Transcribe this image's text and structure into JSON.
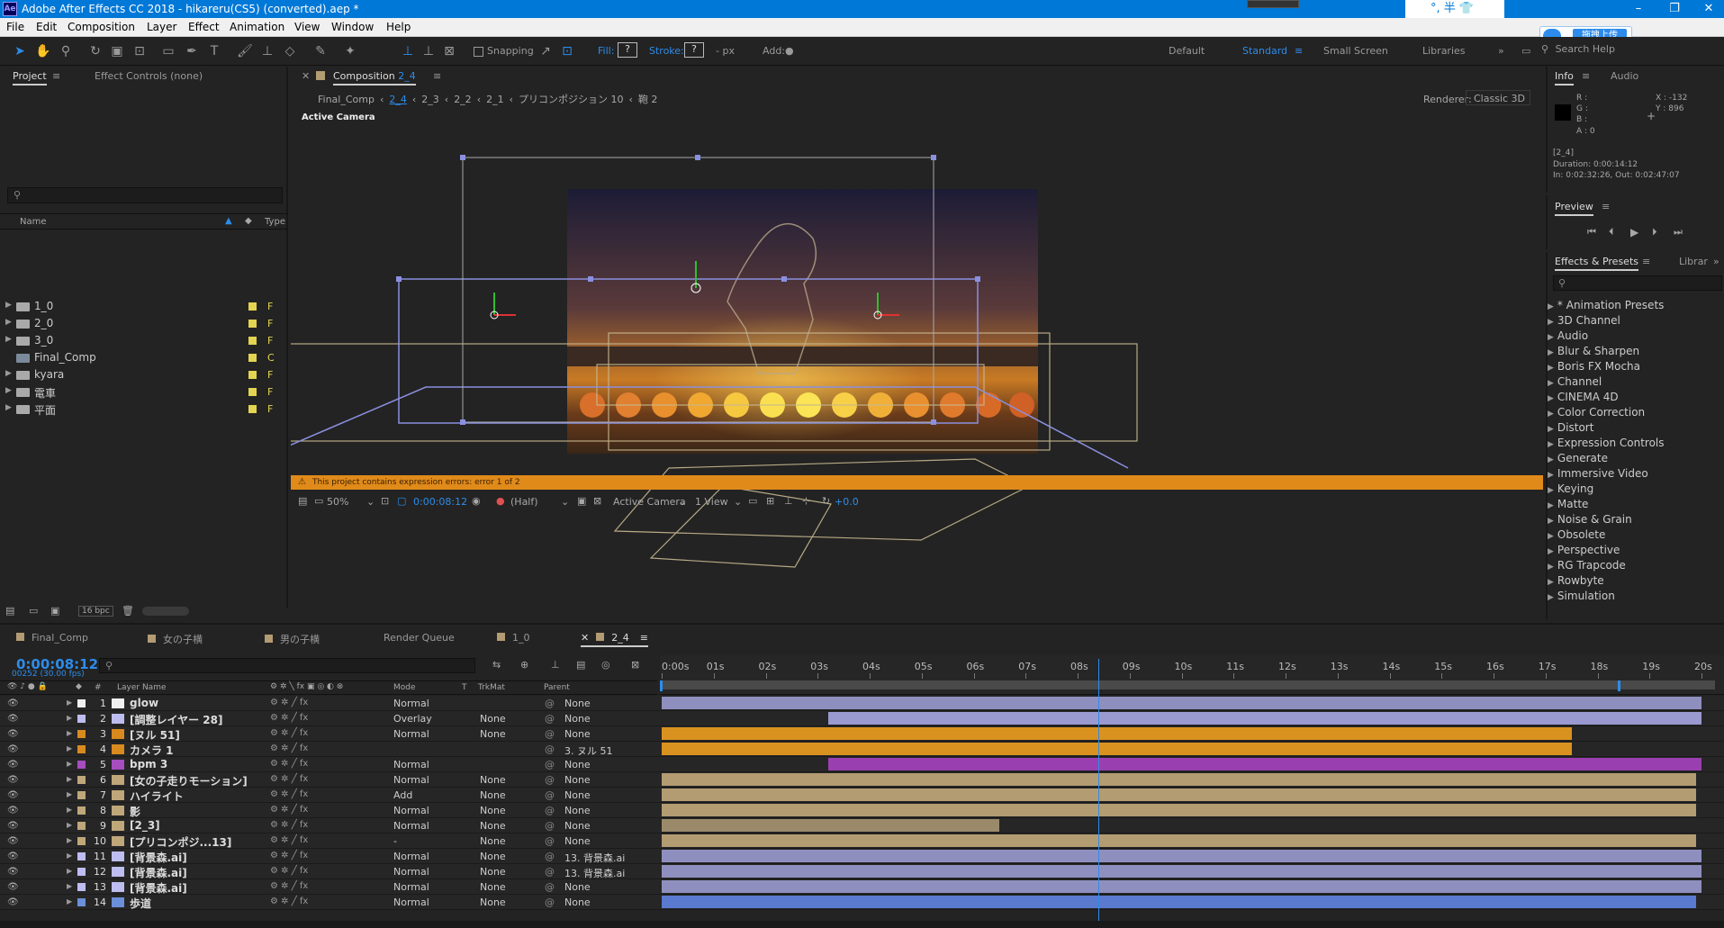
{
  "window": {
    "title": "Adobe After Effects CC 2018 - hikareru(CS5) (converted).aep *",
    "app_icon": "Ae",
    "tray_text": "°, 半",
    "upload_button": "拖拽上传"
  },
  "menu": [
    "File",
    "Edit",
    "Composition",
    "Layer",
    "Effect",
    "Animation",
    "View",
    "Window",
    "Help"
  ],
  "toolbar": {
    "snapping": "Snapping",
    "fill_label": "Fill:",
    "fill_value": "?",
    "stroke_label": "Stroke:",
    "stroke_value": "?",
    "stroke_unit": "- px",
    "add_label": "Add:",
    "workspaces": [
      "Default",
      "Standard",
      "Small Screen",
      "Libraries"
    ],
    "active_workspace": "Standard",
    "search_placeholder": "Search Help"
  },
  "project_panel": {
    "tabs": [
      "Project",
      "Effect Controls (none)"
    ],
    "columns": {
      "name": "Name",
      "type": "Type"
    },
    "items": [
      {
        "name": "1_0",
        "type": "F",
        "kind": "folder"
      },
      {
        "name": "2_0",
        "type": "F",
        "kind": "folder"
      },
      {
        "name": "3_0",
        "type": "F",
        "kind": "folder"
      },
      {
        "name": "Final_Comp",
        "type": "C",
        "kind": "comp"
      },
      {
        "name": "kyara",
        "type": "F",
        "kind": "folder"
      },
      {
        "name": "電車",
        "type": "F",
        "kind": "folder"
      },
      {
        "name": "平面",
        "type": "F",
        "kind": "folder"
      }
    ],
    "bpc": "16 bpc"
  },
  "composition": {
    "tab_label": "Composition",
    "tab_name": "2_4",
    "breadcrumbs": [
      "Final_Comp",
      "2_4",
      "2_3",
      "2_2",
      "2_1",
      "プリコンポジション 10",
      "鞄 2"
    ],
    "active_breadcrumb": "2_4",
    "renderer_label": "Renderer:",
    "renderer_value": "Classic 3D",
    "view_label": "Active Camera",
    "warning": "This project contains expression errors: error 1 of 2",
    "zoom": "50%",
    "timecode": "0:00:08:12",
    "resolution": "(Half)",
    "camera": "Active Camera",
    "views": "1 View",
    "exposure": "+0.0"
  },
  "info_panel": {
    "tabs": [
      "Info",
      "Audio"
    ],
    "r": "R :",
    "g": "G :",
    "b": "B :",
    "a": "A : 0",
    "x": "X : -132",
    "y": "Y : 896",
    "layer": "[2_4]",
    "duration": "Duration: 0:00:14:12",
    "in_out": "In: 0:02:32:26, Out: 0:02:47:07"
  },
  "preview_panel": {
    "title": "Preview"
  },
  "effects_panel": {
    "tabs": [
      "Effects & Presets",
      "Librar"
    ],
    "items": [
      "* Animation Presets",
      "3D Channel",
      "Audio",
      "Blur & Sharpen",
      "Boris FX Mocha",
      "Channel",
      "CINEMA 4D",
      "Color Correction",
      "Distort",
      "Expression Controls",
      "Generate",
      "Immersive Video",
      "Keying",
      "Matte",
      "Noise & Grain",
      "Obsolete",
      "Perspective",
      "RG Trapcode",
      "Rowbyte",
      "Simulation"
    ]
  },
  "timeline": {
    "tabs": [
      "Final_Comp",
      "女の子横",
      "男の子横",
      "Render Queue",
      "1_0",
      "2_4"
    ],
    "active_tab": "2_4",
    "timecode": "0:00:08:12",
    "frames": "00252 (30.00 fps)",
    "columns": {
      "layer_name": "Layer Name",
      "mode": "Mode",
      "t": "T",
      "trkmat": "TrkMat",
      "parent": "Parent"
    },
    "ruler": [
      "0:00s",
      "01s",
      "02s",
      "03s",
      "04s",
      "05s",
      "06s",
      "07s",
      "08s",
      "09s",
      "10s",
      "11s",
      "12s",
      "13s",
      "14s",
      "15s",
      "16s",
      "17s",
      "18s",
      "19s",
      "20s"
    ],
    "playhead_seconds": 8.4,
    "layers": [
      {
        "num": "1",
        "name": "glow",
        "mode": "Normal",
        "trkmat": "",
        "parent": "None",
        "label_color": "#f0f0f0",
        "bar_color": "#8f8fbf",
        "start": 0,
        "end": 20
      },
      {
        "num": "2",
        "name": "[調整レイヤー 28]",
        "mode": "Overlay",
        "trkmat": "None",
        "parent": "None",
        "label_color": "#bdbdf0",
        "bar_color": "#9a9ad0",
        "start": 3.2,
        "end": 20
      },
      {
        "num": "3",
        "name": "[ヌル 51]",
        "mode": "Normal",
        "trkmat": "None",
        "parent": "None",
        "label_color": "#d98a1f",
        "bar_color": "#d9921f",
        "start": 0,
        "end": 17.5
      },
      {
        "num": "4",
        "name": "カメラ 1",
        "mode": "",
        "trkmat": "",
        "parent": "3. ヌル 51",
        "label_color": "#d98a1f",
        "bar_color": "#d9921f",
        "start": 0,
        "end": 17.5
      },
      {
        "num": "5",
        "name": "bpm 3",
        "mode": "Normal",
        "trkmat": "",
        "parent": "None",
        "label_color": "#a64dbf",
        "bar_color": "#9a3fb0",
        "start": 3.2,
        "end": 20
      },
      {
        "num": "6",
        "name": "[女の子走りモーション]",
        "mode": "Normal",
        "trkmat": "None",
        "parent": "None",
        "label_color": "#bfa77a",
        "bar_color": "#b39b72",
        "start": 0,
        "end": 19.9
      },
      {
        "num": "7",
        "name": "ハイライト",
        "mode": "Add",
        "trkmat": "None",
        "parent": "None",
        "label_color": "#bfa77a",
        "bar_color": "#b39b72",
        "start": 0,
        "end": 19.9
      },
      {
        "num": "8",
        "name": "影",
        "mode": "Normal",
        "trkmat": "None",
        "parent": "None",
        "label_color": "#bfa77a",
        "bar_color": "#b39b72",
        "start": 0,
        "end": 19.9
      },
      {
        "num": "9",
        "name": "[2_3]",
        "mode": "Normal",
        "trkmat": "None",
        "parent": "None",
        "label_color": "#bfa77a",
        "bar_color": "#9a8a6a",
        "start": 0,
        "end": 6.5
      },
      {
        "num": "10",
        "name": "[プリコンポジ...13]",
        "mode": "-",
        "trkmat": "None",
        "parent": "None",
        "label_color": "#bfa77a",
        "bar_color": "#b39b72",
        "start": 0,
        "end": 19.9
      },
      {
        "num": "11",
        "name": "[背景森.ai]",
        "mode": "Normal",
        "trkmat": "None",
        "parent": "13. 背景森.ai",
        "label_color": "#bdbdf0",
        "bar_color": "#8f8fbf",
        "start": 0,
        "end": 20
      },
      {
        "num": "12",
        "name": "[背景森.ai]",
        "mode": "Normal",
        "trkmat": "None",
        "parent": "13. 背景森.ai",
        "label_color": "#bdbdf0",
        "bar_color": "#8f8fbf",
        "start": 0,
        "end": 20
      },
      {
        "num": "13",
        "name": "[背景森.ai]",
        "mode": "Normal",
        "trkmat": "None",
        "parent": "None",
        "label_color": "#bdbdf0",
        "bar_color": "#8f8fbf",
        "start": 0,
        "end": 20
      },
      {
        "num": "14",
        "name": "歩道",
        "mode": "Normal",
        "trkmat": "None",
        "parent": "None",
        "label_color": "#6b8fd9",
        "bar_color": "#5a7ad0",
        "start": 0,
        "end": 19.9
      }
    ]
  },
  "colors": {
    "accent": "#2d8ceb",
    "warning": "#e08a1a",
    "titlebar": "#0078d7"
  }
}
